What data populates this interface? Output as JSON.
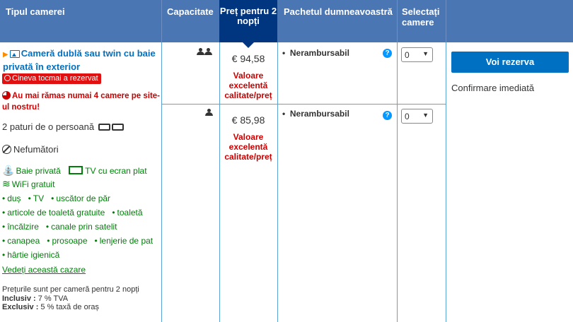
{
  "header": {
    "room_type": "Tipul camerei",
    "capacity": "Capacitate",
    "price": "Preț pentru 2 nopți",
    "package": "Pachetul dumneavoastră",
    "select": "Selectați camere"
  },
  "room": {
    "title": "Cameră dublă sau twin cu baie privată în exterior",
    "badge": "Cineva tocmai a rezervat",
    "warning": "Au mai rămas numai 4 camere pe site-ul nostru!",
    "beds": "2 paturi de o persoană",
    "smoking": "Nefumători",
    "facilities_main": [
      "Baie privată",
      "TV cu ecran plat",
      "WiFi gratuit"
    ],
    "amenities": [
      "duș",
      "TV",
      "uscător de păr",
      "articole de toaletă gratuite",
      "toaletă",
      "încălzire",
      "canale prin satelit",
      "canapea",
      "prosoape",
      "lenjerie de pat",
      "hârtie igienică"
    ],
    "see_link": "Vedeți această cazare",
    "note": {
      "line1": "Prețurile sunt per cameră pentru 2 nopți",
      "inclusive_label": "Inclusiv :",
      "inclusive_value": "7 % TVA",
      "exclusive_label": "Exclusiv :",
      "exclusive_value": "5 % taxă de oraș"
    }
  },
  "options": [
    {
      "occupancy": 2,
      "price": "€ 94,58",
      "deal": "Valoare excelentă calitate/preț",
      "package": "Nerambursabil",
      "qty": "0"
    },
    {
      "occupancy": 1,
      "price": "€ 85,98",
      "deal": "Valoare excelentă calitate/preț",
      "package": "Nerambursabil",
      "qty": "0"
    }
  ],
  "reserve_button": "Voi rezerva",
  "confirmation": "Confirmare imediată",
  "colors": {
    "header": "#4b76b4",
    "price_header": "#003580",
    "link": "#0071c2",
    "green": "#008009",
    "red": "#cc0000"
  }
}
